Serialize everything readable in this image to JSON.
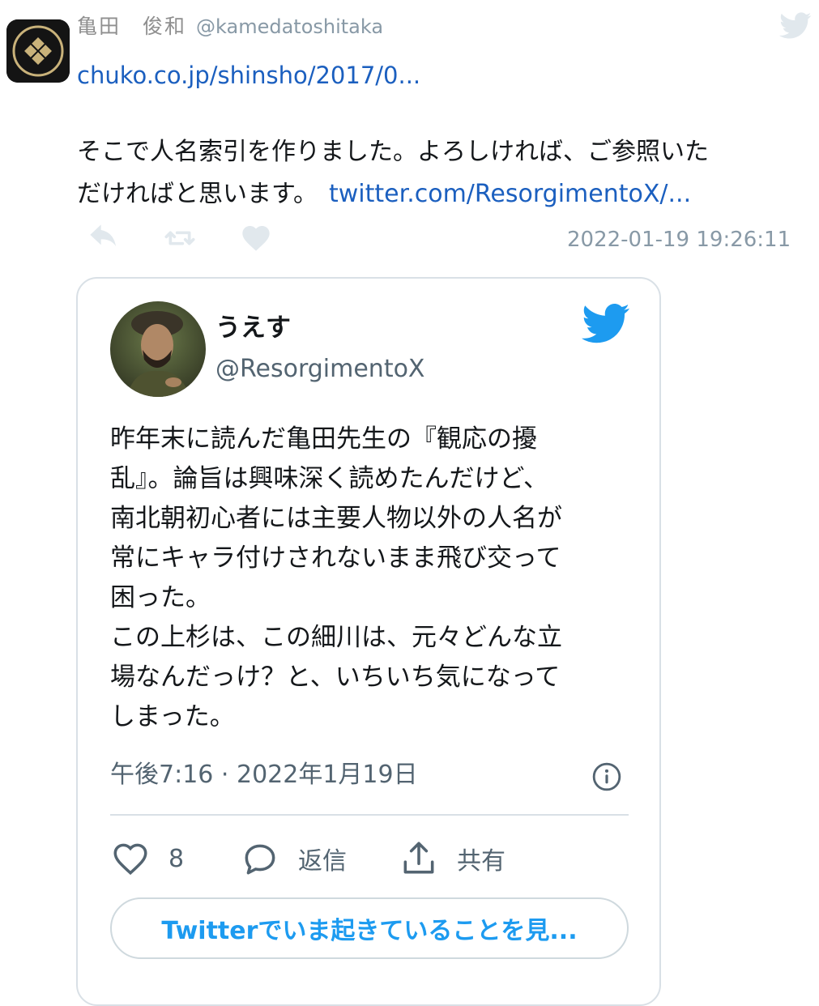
{
  "tweet": {
    "author_name": "亀田　俊和",
    "author_handle": "@kamedatoshitaka",
    "avatar_icon": "family-crest-icon",
    "source_icon": "twitter-bird-icon",
    "link_url_text": "chuko.co.jp/shinsho/2017/0...",
    "text_line1": "そこで人名索引を作りました。よろしければ、ご参照いた",
    "text_line2": "だければと思います。",
    "inline_link_text": "twitter.com/ResorgimentoX/...",
    "timestamp": "2022-01-19 19:26:11",
    "actions": {
      "reply_icon": "reply-icon",
      "retweet_icon": "retweet-icon",
      "like_icon": "heart-icon"
    }
  },
  "embedded": {
    "display_name": "うえす",
    "handle": "@ResorgimentoX",
    "brand_icon": "twitter-bird-icon",
    "body_lines": [
      "昨年末に読んだ亀田先生の『観応の擾",
      "乱』。論旨は興味深く読めたんだけど、",
      "南北朝初心者には主要人物以外の人名が",
      "常にキャラ付けされないまま飛び交って",
      "困った。",
      "この上杉は、この細川は、元々どんな立",
      "場なんだっけ？と、いちいち気になって",
      "しまった。"
    ],
    "time": "午後7:16 · 2022年1月19日",
    "info_icon": "info-icon",
    "like_count": "8",
    "reply_label": "返信",
    "share_label": "共有",
    "cta_label": "Twitterでいま起きていることを見..."
  },
  "colors": {
    "link": "#1b5fbf",
    "twitter_blue": "#1d9bf0",
    "muted": "#8899a6",
    "border": "#d9e0e6"
  }
}
